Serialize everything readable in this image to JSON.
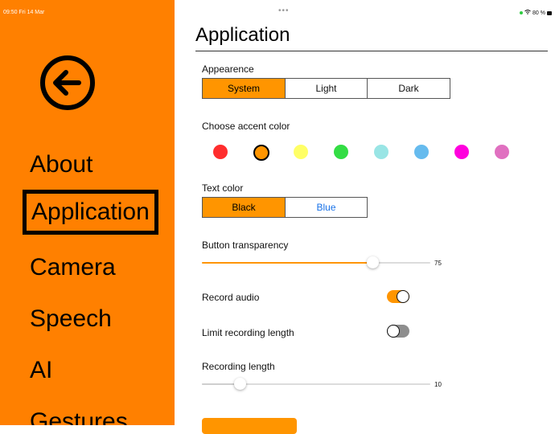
{
  "status_bar": {
    "time": "09:50  Fri 14 Mar",
    "dots": "•••",
    "battery": "80 %"
  },
  "sidebar": {
    "background": "#ff8000",
    "back_icon": "arrow-left-circle-icon",
    "items": [
      {
        "label": "About"
      },
      {
        "label": "Application",
        "selected": true
      },
      {
        "label": "Camera"
      },
      {
        "label": "Speech"
      },
      {
        "label": "AI"
      },
      {
        "label": "Gestures"
      }
    ]
  },
  "main": {
    "title": "Application",
    "appearance": {
      "label": "Appearence",
      "options": [
        "System",
        "Light",
        "Dark"
      ],
      "selected": "System"
    },
    "accent": {
      "label": "Choose accent color",
      "colors": [
        "#ff2d2d",
        "#ff9500",
        "#ffff66",
        "#33dd44",
        "#99e5e5",
        "#66bbee",
        "#ff00dd",
        "#e070c0"
      ],
      "selected": "#ff9500"
    },
    "text_color": {
      "label": "Text color",
      "options": [
        "Black",
        "Blue"
      ],
      "selected": "Black"
    },
    "button_transparency": {
      "label": "Button transparency",
      "value": "75",
      "fraction": 0.75
    },
    "record_audio": {
      "label": "Record audio",
      "on": true
    },
    "limit_recording": {
      "label": "Limit recording length",
      "on": false
    },
    "recording_length": {
      "label": "Recording length",
      "value": "10",
      "fraction": 0.17
    }
  },
  "accent_color": "#ff9500"
}
